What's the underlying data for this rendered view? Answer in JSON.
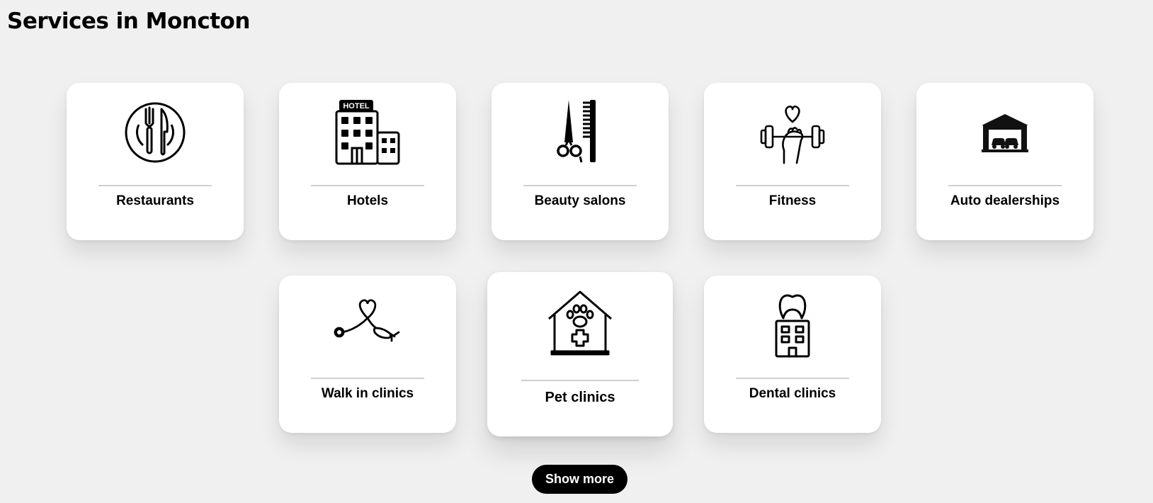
{
  "page": {
    "title": "Services in Moncton"
  },
  "services": [
    {
      "label": "Restaurants",
      "icon": "plate-cutlery-icon"
    },
    {
      "label": "Hotels",
      "icon": "hotel-building-icon",
      "sign": "HOTEL"
    },
    {
      "label": "Beauty salons",
      "icon": "scissors-comb-icon"
    },
    {
      "label": "Fitness",
      "icon": "dumbbell-heart-icon"
    },
    {
      "label": "Auto dealerships",
      "icon": "car-garage-icon"
    },
    {
      "label": "Walk in clinics",
      "icon": "stethoscope-icon"
    },
    {
      "label": "Pet clinics",
      "icon": "pet-clinic-house-icon"
    },
    {
      "label": "Dental clinics",
      "icon": "dental-building-icon"
    }
  ],
  "actions": {
    "show_more_label": "Show more"
  },
  "colors": {
    "background": "#f0f0f0",
    "card": "#ffffff",
    "button": "#000000",
    "button_text": "#ffffff"
  }
}
